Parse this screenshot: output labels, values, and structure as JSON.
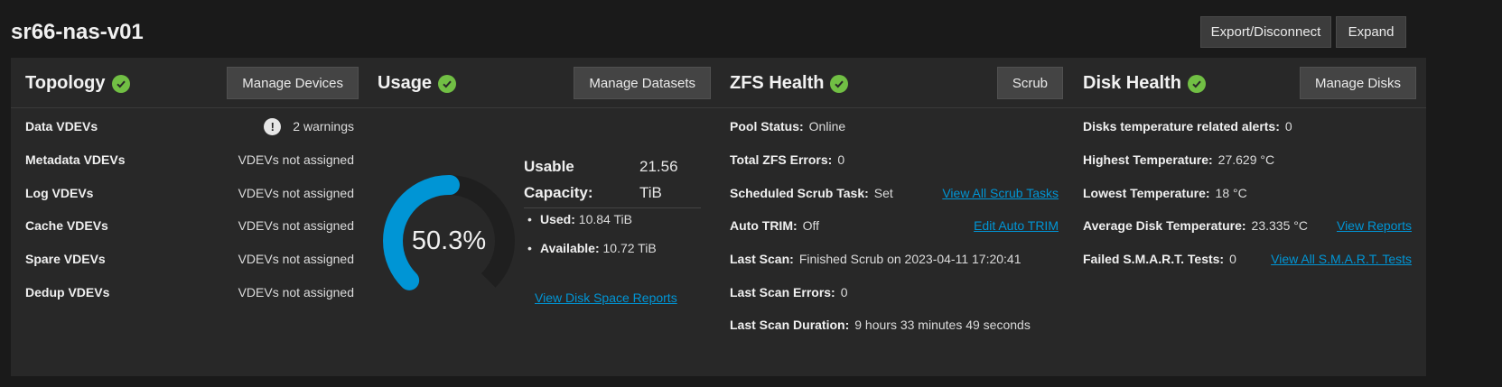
{
  "pool": {
    "name": "sr66-nas-v01",
    "export_label": "Export/Disconnect",
    "expand_label": "Expand"
  },
  "colors": {
    "accent": "#0095d5",
    "healthy": "#71bf44",
    "card_bg": "#282828",
    "page_bg": "#1a1a1a"
  },
  "topology": {
    "title": "Topology",
    "button": "Manage Devices",
    "rows": [
      {
        "label": "Data VDEVs",
        "value": "2 warnings",
        "icon": "exclamation-icon"
      },
      {
        "label": "Metadata VDEVs",
        "value": "VDEVs not assigned"
      },
      {
        "label": "Log VDEVs",
        "value": "VDEVs not assigned"
      },
      {
        "label": "Cache VDEVs",
        "value": "VDEVs not assigned"
      },
      {
        "label": "Spare VDEVs",
        "value": "VDEVs not assigned"
      },
      {
        "label": "Dedup VDEVs",
        "value": "VDEVs not assigned"
      }
    ]
  },
  "usage": {
    "title": "Usage",
    "button": "Manage Datasets",
    "percent_text": "50.3%",
    "percent": 50.3,
    "usable_label_1": "Usable",
    "usable_label_2": "Capacity:",
    "usable_value_1": "21.56",
    "usable_value_2": "TiB",
    "used_label": "Used:",
    "used_value": "10.84 TiB",
    "available_label": "Available:",
    "available_value": "10.72 TiB",
    "reports_link": "View Disk Space Reports"
  },
  "zfs": {
    "title": "ZFS Health",
    "button": "Scrub",
    "rows": [
      {
        "label": "Pool Status:",
        "value": "Online",
        "link": ""
      },
      {
        "label": "Total ZFS Errors:",
        "value": "0",
        "link": ""
      },
      {
        "label": "Scheduled Scrub Task:",
        "value": "Set",
        "link": "View All Scrub Tasks"
      },
      {
        "label": "Auto TRIM:",
        "value": "Off",
        "link": "Edit Auto TRIM"
      },
      {
        "label": "Last Scan:",
        "value": "Finished Scrub on 2023-04-11 17:20:41",
        "link": ""
      },
      {
        "label": "Last Scan Errors:",
        "value": "0",
        "link": ""
      },
      {
        "label": "Last Scan Duration:",
        "value": "9 hours 33 minutes 49 seconds",
        "link": ""
      }
    ]
  },
  "disk": {
    "title": "Disk Health",
    "button": "Manage Disks",
    "rows": [
      {
        "label": "Disks temperature related alerts:",
        "value": "0",
        "link": ""
      },
      {
        "label": "Highest Temperature:",
        "value": "27.629 °C",
        "link": ""
      },
      {
        "label": "Lowest Temperature:",
        "value": "18 °C",
        "link": ""
      },
      {
        "label": "Average Disk Temperature:",
        "value": "23.335 °C",
        "link": "View Reports"
      },
      {
        "label": "Failed S.M.A.R.T. Tests:",
        "value": "0",
        "link": "View All S.M.A.R.T. Tests"
      }
    ]
  }
}
